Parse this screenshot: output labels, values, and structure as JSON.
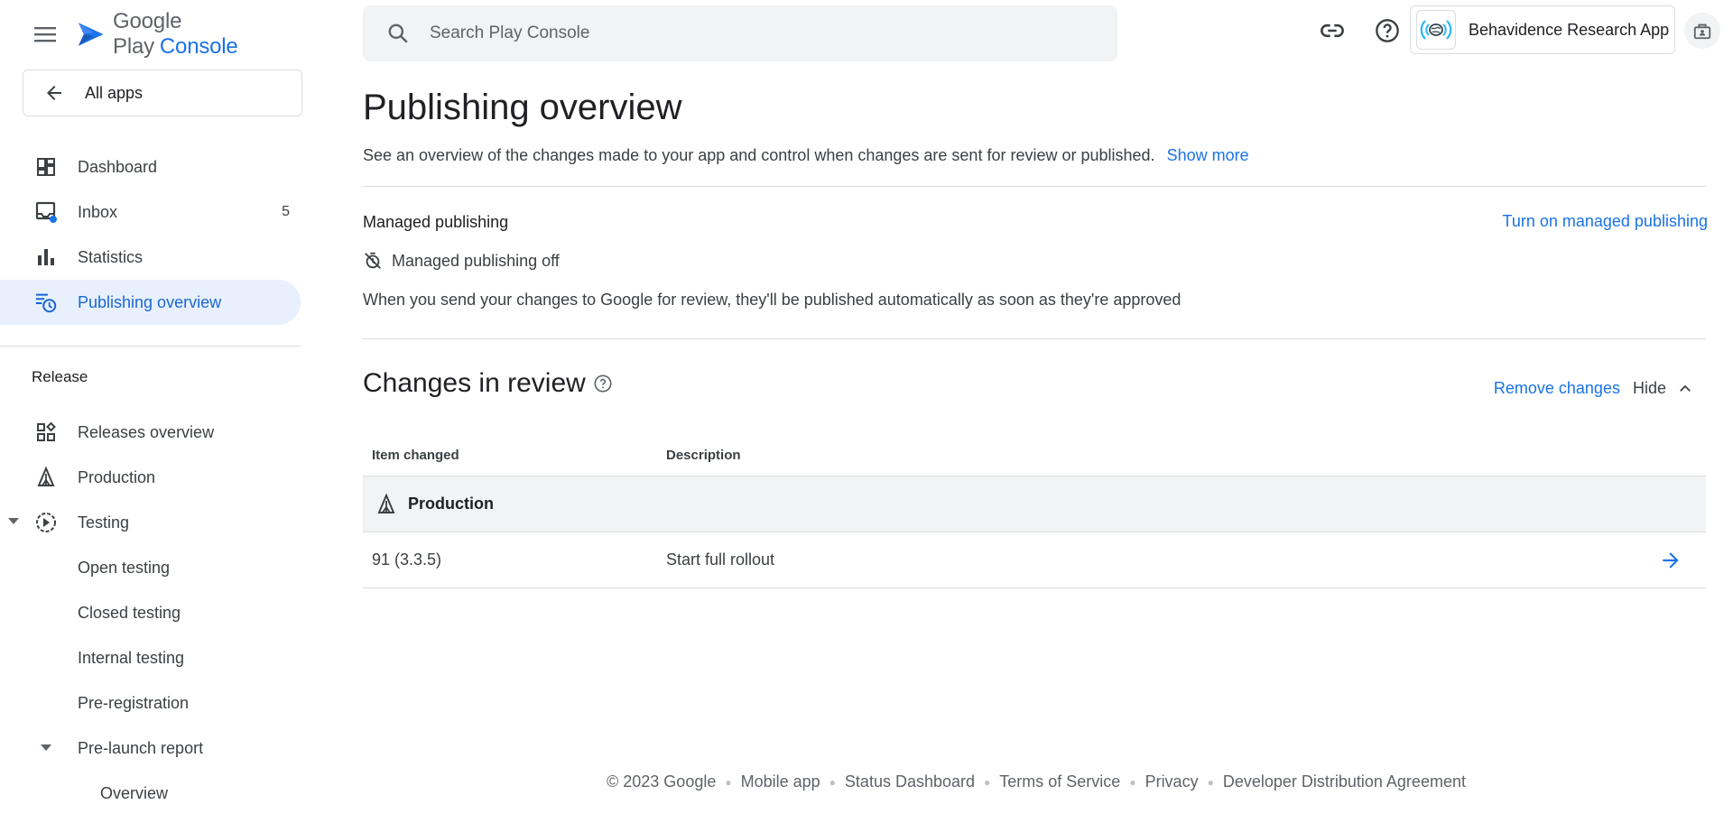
{
  "brand": {
    "name": "Google Play",
    "suffix": "Console"
  },
  "sidebar": {
    "back_label": "All apps",
    "items": [
      {
        "label": "Dashboard",
        "icon": "dashboard-icon"
      },
      {
        "label": "Inbox",
        "icon": "inbox-icon",
        "count": "5"
      },
      {
        "label": "Statistics",
        "icon": "bar-chart-icon"
      },
      {
        "label": "Publishing overview",
        "icon": "publishing-overview-icon",
        "active": true
      }
    ],
    "release_title": "Release",
    "release_items": [
      {
        "label": "Releases overview",
        "icon": "releases-overview-icon"
      },
      {
        "label": "Production",
        "icon": "production-icon"
      },
      {
        "label": "Testing",
        "icon": "testing-icon",
        "expanded": true
      },
      {
        "label": "Open testing"
      },
      {
        "label": "Closed testing"
      },
      {
        "label": "Internal testing"
      },
      {
        "label": "Pre-registration"
      },
      {
        "label": "Pre-launch report",
        "expanded": true
      },
      {
        "label": "Overview"
      }
    ]
  },
  "search": {
    "placeholder": "Search Play Console"
  },
  "app": {
    "name": "Behavidence Research App"
  },
  "page": {
    "title": "Publishing overview",
    "description": "See an overview of the changes made to your app and control when changes are sent for review or published.",
    "show_more": "Show more"
  },
  "managed": {
    "title": "Managed publishing",
    "link": "Turn on managed publishing",
    "status": "Managed publishing off",
    "description": "When you send your changes to Google for review, they'll be published automatically as soon as they're approved"
  },
  "changes": {
    "title": "Changes in review",
    "remove": "Remove changes",
    "hide": "Hide",
    "columns": [
      "Item changed",
      "Description"
    ],
    "group": "Production",
    "rows": [
      {
        "item": "91 (3.3.5)",
        "description": "Start full rollout"
      }
    ]
  },
  "footer": {
    "copyright": "© 2023 Google",
    "links": [
      "Mobile app",
      "Status Dashboard",
      "Terms of Service",
      "Privacy",
      "Developer Distribution Agreement"
    ]
  },
  "colors": {
    "accent": "#1a73e8",
    "active_bg": "#e8f0fe",
    "divider": "#dadce0"
  }
}
